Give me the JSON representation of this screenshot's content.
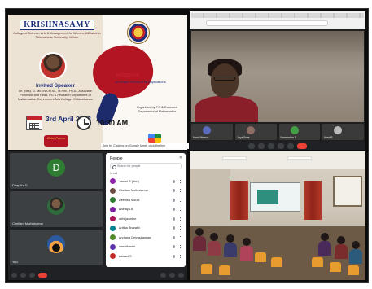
{
  "poster": {
    "college_name": "KRISHNASAMY",
    "college_subtitle": "College of Science, Arts & Management for Women, Affiliated to Thiruvalluvar University, Vellore",
    "emblem_icon": "college-emblem-icon",
    "speaker_label": "Invited Speaker",
    "speaker_details": "Dr. (Mrs). G. MEENA M.Sc., M.Phil., Ph.D., Associate Professor and Head, PG & Research Department of Mathematics, Government Arts College, Chidambaram",
    "webinar_title": "WEBINAR",
    "webinar_subtitle": "on Graph Theory & Its Applications",
    "organised_by": "Organised by PG & Research Department of Mathematics",
    "date": "3rd April 2023",
    "time": "10:30 AM",
    "patron_label": "Chief Patron",
    "meet_note": "Join by Clicking on Google Meet, click the link"
  },
  "call": {
    "participants": [
      {
        "name": "Mani Meena"
      },
      {
        "name": "Jaya Sree"
      },
      {
        "name": "Narmadha S"
      },
      {
        "name": "Kavi R"
      }
    ]
  },
  "participants_panel": {
    "tiles": [
      {
        "letter": "D",
        "name": "Deepika D"
      },
      {
        "letter": "",
        "name": "Chellam Muthukumar"
      },
      {
        "letter": "",
        "name": "You"
      }
    ],
    "people_title": "People",
    "search_placeholder": "Search for people",
    "section_label": "In call",
    "people": [
      {
        "name": "Janani S (You)"
      },
      {
        "name": "Chellam Muthukumar"
      },
      {
        "name": "Deepika Murali"
      },
      {
        "name": "Abinaya A"
      },
      {
        "name": "abhi jasmine"
      },
      {
        "name": "Anitha Bharathi"
      },
      {
        "name": "Archana Deivasigamani"
      },
      {
        "name": "amruthashri"
      },
      {
        "name": "Aswani S"
      }
    ]
  },
  "colors": {
    "maroon": "#b31622",
    "navy": "#1b2f7a",
    "meet_dark": "#202124",
    "end_call": "#ea4335"
  }
}
